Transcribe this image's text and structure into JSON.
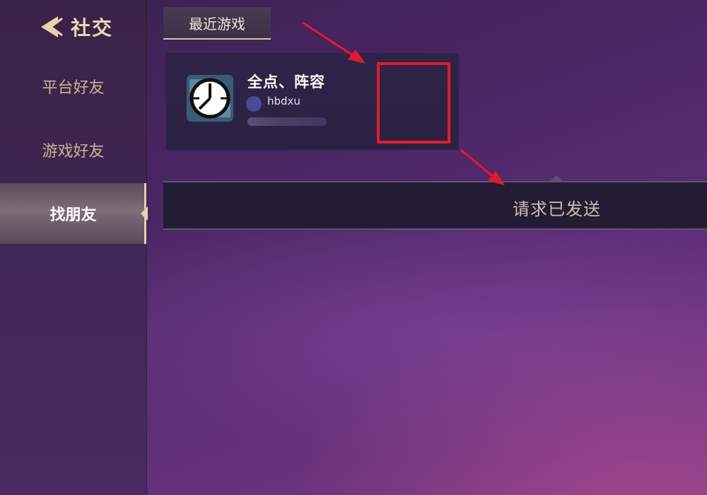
{
  "header": {
    "title": "社交",
    "back_icon": "chevron-left-icon"
  },
  "sidebar": {
    "items": [
      {
        "label": "平台好友"
      },
      {
        "label": "游戏好友"
      },
      {
        "label": "找朋友"
      }
    ],
    "active_index": 2
  },
  "main": {
    "tab_label": "最近游戏",
    "player": {
      "name": "全点、阵容",
      "handle": "hbdxu",
      "avatar_icon": "clock-avatar-icon"
    },
    "status_text": "请求已发送"
  },
  "colors": {
    "accent_gold": "#e6d3a6",
    "highlight_red": "#e8182b",
    "background_purple": "#4a2663"
  }
}
